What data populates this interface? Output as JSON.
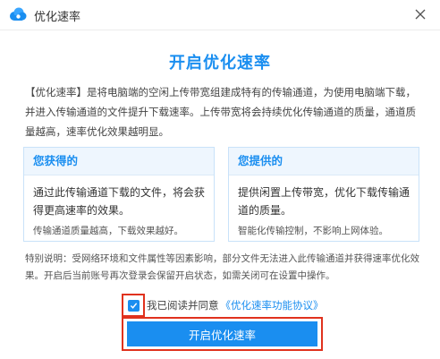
{
  "window": {
    "title": "优化速率",
    "logo_icon": "cloud-logo-icon",
    "close_icon": "close-icon"
  },
  "main": {
    "heading": "开启优化速率",
    "intro": "【优化速率】是将电脑端的空闲上传带宽组建成特有的传输通道，为使用电脑端下载，并进入传输通道的文件提升下载速率。上传带宽将会持续优化传输通道的质量，通道质量越高，速率优化效果越明显。"
  },
  "cards": {
    "gain": {
      "title": "您获得的",
      "body": "通过此传输通道下载的文件，将会获得更高速率的效果。",
      "note": "传输通道质量越高，下载效果越好。"
    },
    "provide": {
      "title": "您提供的",
      "body": "提供闲置上传带宽，优化下载传输通道的质量。",
      "note": "智能化传输控制，不影响上网体验。"
    }
  },
  "notice": "特别说明：受网络环境和文件属性等因素影响，部分文件无法进入此传输通道并获得速率优化效果。开启后当前账号再次登录会保留开启状态，如需关闭可在设置中操作。",
  "agreement": {
    "checked": true,
    "text": "我已阅读并同意",
    "link": "《优化速率功能协议》"
  },
  "action": {
    "button_label": "开启优化速率"
  },
  "colors": {
    "accent": "#1a8ef0",
    "highlight": "#e0321e",
    "card_header_bg": "#eef6fe"
  }
}
